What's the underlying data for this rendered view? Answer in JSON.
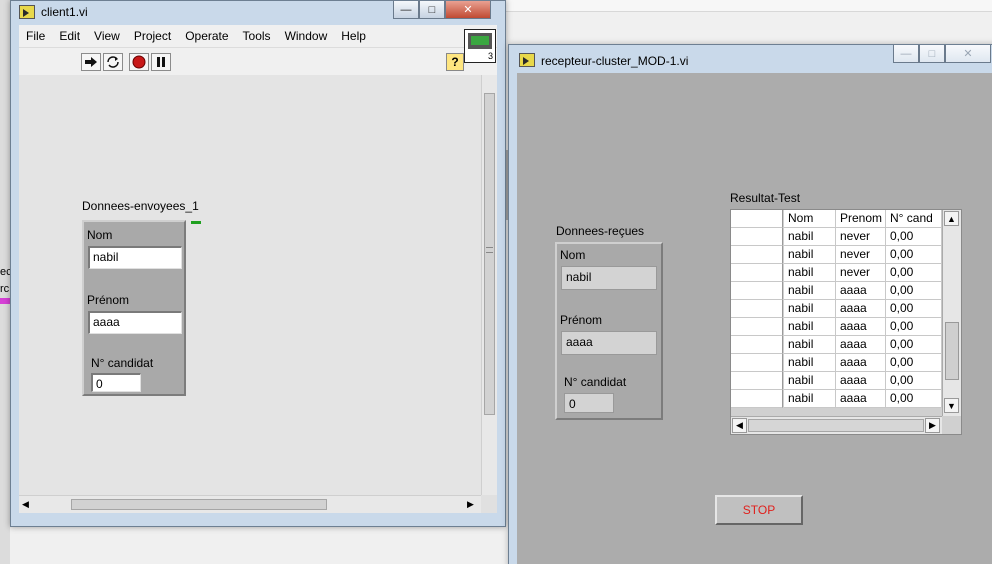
{
  "window1": {
    "title": "client1.vi",
    "menu": [
      "File",
      "Edit",
      "View",
      "Project",
      "Operate",
      "Tools",
      "Window",
      "Help"
    ],
    "toolbar": {
      "help": "?"
    },
    "vi_icon_badge": "3",
    "cluster": {
      "title": "Donnees-envoyees_1",
      "nom_label": "Nom",
      "nom_value": "nabil",
      "prenom_label": "Prénom",
      "prenom_value": "aaaa",
      "candidat_label": "N° candidat",
      "candidat_value": "0"
    }
  },
  "window2": {
    "title": "recepteur-cluster_MOD-1.vi",
    "cluster": {
      "title": "Donnees-reçues",
      "nom_label": "Nom",
      "nom_value": "nabil",
      "prenom_label": "Prénom",
      "prenom_value": "aaaa",
      "candidat_label": "N° candidat",
      "candidat_value": "0"
    },
    "table": {
      "title": "Resultat-Test",
      "headers": [
        "Nom",
        "Prenom",
        "N° cand"
      ],
      "rows": [
        [
          "nabil",
          "never",
          "0,00"
        ],
        [
          "nabil",
          "never",
          "0,00"
        ],
        [
          "nabil",
          "never",
          "0,00"
        ],
        [
          "nabil",
          "aaaa",
          "0,00"
        ],
        [
          "nabil",
          "aaaa",
          "0,00"
        ],
        [
          "nabil",
          "aaaa",
          "0,00"
        ],
        [
          "nabil",
          "aaaa",
          "0,00"
        ],
        [
          "nabil",
          "aaaa",
          "0,00"
        ],
        [
          "nabil",
          "aaaa",
          "0,00"
        ],
        [
          "nabil",
          "aaaa",
          "0,00"
        ]
      ]
    },
    "stop_label": "STOP"
  },
  "background": {
    "fragment_a": "ec",
    "fragment_b": "rc"
  },
  "colors": {
    "stop_text": "#e0201c",
    "panel_bg": "#acacac",
    "cluster_bg": "#a9a9a9"
  }
}
